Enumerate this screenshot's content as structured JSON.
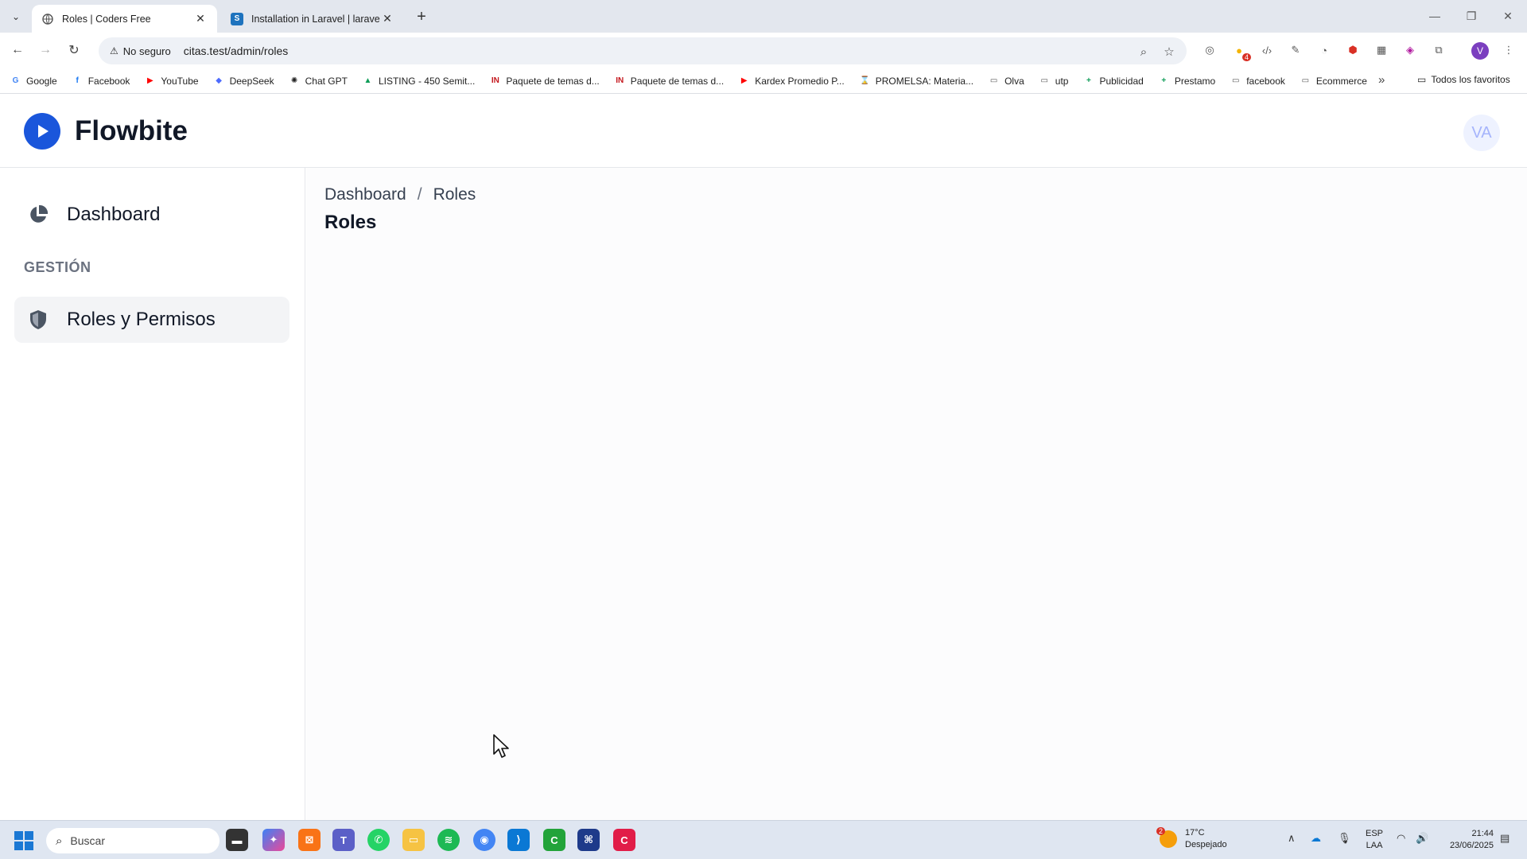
{
  "browser": {
    "tabs": [
      {
        "title": "Roles | Coders Free",
        "active": true
      },
      {
        "title": "Installation in Laravel | laravel-p",
        "active": false
      }
    ],
    "security_label": "No seguro",
    "url": "citas.test/admin/roles",
    "profile_initial": "V",
    "extension_badge": "4",
    "bookmarks": [
      {
        "label": "Google",
        "icon": "G",
        "color": "#4285f4"
      },
      {
        "label": "Facebook",
        "icon": "f",
        "color": "#1877f2"
      },
      {
        "label": "YouTube",
        "icon": "▶",
        "color": "#ff0000"
      },
      {
        "label": "DeepSeek",
        "icon": "◆",
        "color": "#4d6bfe"
      },
      {
        "label": "Chat GPT",
        "icon": "✺",
        "color": "#222222"
      },
      {
        "label": "LISTING - 450 Semit...",
        "icon": "▲",
        "color": "#0f9d58"
      },
      {
        "label": "Paquete de temas d...",
        "icon": "IN",
        "color": "#c4161c"
      },
      {
        "label": "Paquete de temas d...",
        "icon": "IN",
        "color": "#c4161c"
      },
      {
        "label": "Kardex Promedio P...",
        "icon": "▶",
        "color": "#ff0000"
      },
      {
        "label": "PROMELSA: Materia...",
        "icon": "⌛",
        "color": "#555555"
      },
      {
        "label": "Olva",
        "icon": "▭",
        "color": "#555555"
      },
      {
        "label": "utp",
        "icon": "▭",
        "color": "#555555"
      },
      {
        "label": "Publicidad",
        "icon": "+",
        "color": "#0f9d58"
      },
      {
        "label": "Prestamo",
        "icon": "+",
        "color": "#0f9d58"
      },
      {
        "label": "facebook",
        "icon": "▭",
        "color": "#555555"
      },
      {
        "label": "Ecommerce",
        "icon": "▭",
        "color": "#555555"
      }
    ],
    "all_bookmarks_label": "Todos los favoritos"
  },
  "app": {
    "brand": "Flowbite",
    "user_initials": "VA",
    "sidebar": {
      "dashboard_label": "Dashboard",
      "section_label": "GESTIÓN",
      "roles_label": "Roles y Permisos"
    },
    "breadcrumb": [
      "Dashboard",
      "Roles"
    ],
    "breadcrumb_separator": "/",
    "page_title": "Roles"
  },
  "taskbar": {
    "search_placeholder": "Buscar",
    "weather_badge": "2",
    "temperature": "17°C",
    "weather_desc": "Despejado",
    "lang_1": "ESP",
    "lang_2": "LAA",
    "time": "21:44",
    "date": "23/06/2025"
  },
  "colors": {
    "brand_blue": "#1a56db",
    "sidebar_active_bg": "#f3f4f6"
  }
}
